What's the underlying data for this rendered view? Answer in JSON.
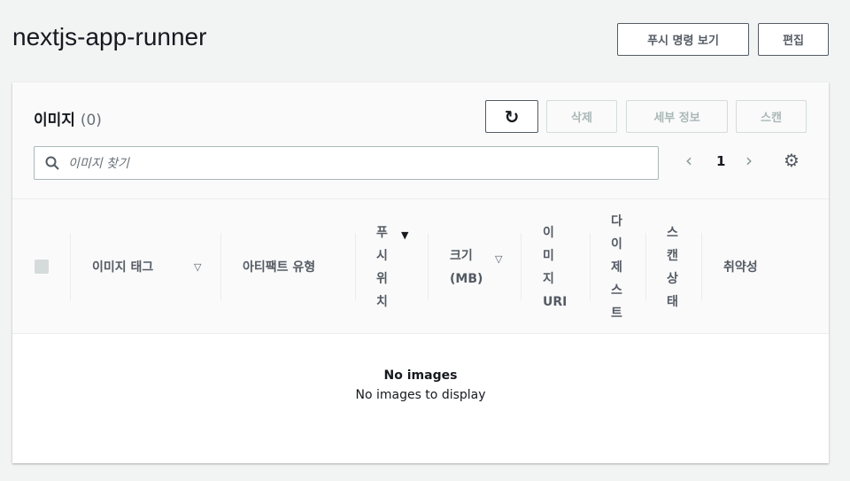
{
  "page": {
    "title": "nextjs-app-runner",
    "push_commands_label": "푸시 명령 보기",
    "edit_label": "편집"
  },
  "images": {
    "heading": "이미지",
    "count": "(0)",
    "actions": {
      "delete": "삭제",
      "details": "세부 정보",
      "scan": "스캔"
    },
    "search_placeholder": "이미지 찾기",
    "page_number": "1",
    "columns": [
      "이미지 태그",
      "아티팩트 유형",
      "푸\n시\n위\n치",
      "크기\n(MB)",
      "이\n미\n지\nURI",
      "다\n이\n제\n스\n트",
      "스\n캔\n상\n태",
      "취약성"
    ],
    "empty_title": "No images",
    "empty_text": "No images to display"
  }
}
